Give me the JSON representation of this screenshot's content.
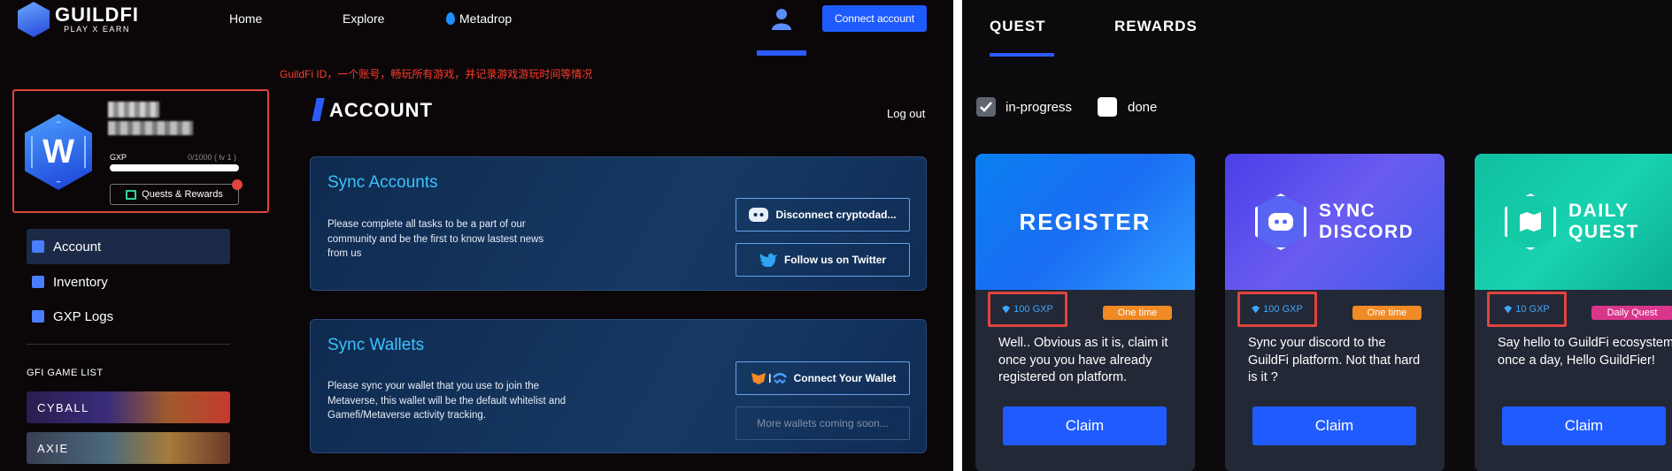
{
  "header": {
    "logo_title": "GUILDFI",
    "logo_subtitle": "PLAY X EARN",
    "nav": [
      "Home",
      "Explore",
      "Metadrop"
    ],
    "connect_label": "Connect account"
  },
  "annotation_note": "GuildFi ID，一个账号，畅玩所有游戏，并记录游戏游玩时间等情况",
  "profile": {
    "avatar_letter": "W",
    "gxp_label": "GXP",
    "gxp_progress": "0/1000 ( lv 1 )",
    "gxp_fraction": 0,
    "quests_button": "Quests & Rewards"
  },
  "sidebar": {
    "items": [
      {
        "label": "Account",
        "icon": "account-icon",
        "active": true
      },
      {
        "label": "Inventory",
        "icon": "inventory-icon",
        "active": false
      },
      {
        "label": "GXP Logs",
        "icon": "gxp-logs-icon",
        "active": false
      }
    ],
    "game_list_title": "GFI GAME LIST",
    "games": [
      "CYBALL",
      "AXIE"
    ]
  },
  "main": {
    "title": "ACCOUNT",
    "logout": "Log out",
    "sync_accounts": {
      "title": "Sync Accounts",
      "text": "Please complete all tasks to be a part of our community and be the first to know lastest news from us",
      "discord_button": "Disconnect cryptodad...",
      "twitter_button": "Follow us on Twitter"
    },
    "sync_wallets": {
      "title": "Sync Wallets",
      "text": "Please sync your wallet that you use to join the Metaverse, this wallet will be the default whitelist and Gamefi/Metaverse activity tracking.",
      "connect_wallet_button": "Connect Your Wallet",
      "more_wallets": "More wallets coming soon..."
    }
  },
  "quest_panel": {
    "tabs": [
      "QUEST",
      "REWARDS"
    ],
    "filters": [
      {
        "label": "in-progress",
        "checked": true
      },
      {
        "label": "done",
        "checked": false
      }
    ],
    "cards": [
      {
        "banner": "REGISTER",
        "banner_line2": "",
        "reward": "100 GXP",
        "frequency": "One time",
        "description": "Well.. Obvious as it is, claim it once you you have already registered on platform.",
        "claim": "Claim",
        "freq_color": "#f08a24"
      },
      {
        "banner": "SYNC",
        "banner_line2": "DISCORD",
        "reward": "100 GXP",
        "frequency": "One time",
        "description": "Sync your discord to the GuildFi platform. Not that hard is it ?",
        "claim": "Claim",
        "freq_color": "#f08a24"
      },
      {
        "banner": "DAILY",
        "banner_line2": "QUEST",
        "reward": "10 GXP",
        "frequency": "Daily Quest",
        "description": "Say hello to GuildFi ecosystem once a day, Hello GuildFier!",
        "claim": "Claim",
        "freq_color": "#d9368b"
      }
    ]
  },
  "colors": {
    "accent": "#1e5bff",
    "highlight": "#e0443f",
    "title_blue": "#3cc3ff"
  }
}
